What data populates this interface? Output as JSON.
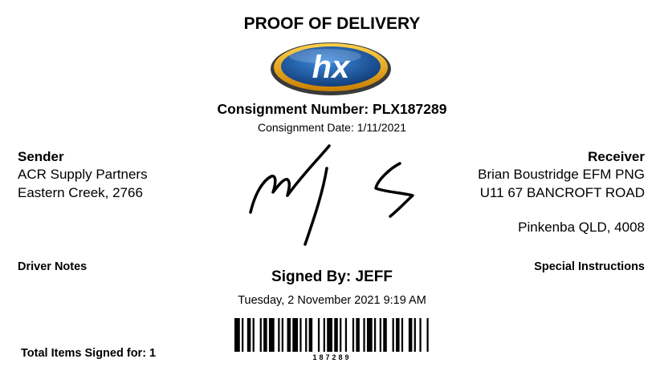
{
  "document": {
    "title": "PROOF OF DELIVERY",
    "logo_text": "hx",
    "consignment_number": "Consignment Number: PLX187289",
    "consignment_date": "Consignment Date: 1/11/2021"
  },
  "sender": {
    "heading": "Sender",
    "lines": [
      "ACR Supply Partners",
      "Eastern Creek, 2766"
    ]
  },
  "receiver": {
    "heading": "Receiver",
    "lines": [
      "Brian Boustridge EFM PNG",
      "U11 67 BANCROFT ROAD",
      "",
      "Pinkenba QLD, 4008"
    ]
  },
  "notes": {
    "driver_notes": "Driver Notes",
    "special_instructions": "Special Instructions"
  },
  "signature": {
    "signed_by": "Signed By: JEFF",
    "signed_date": "Tuesday, 2 November 2021 9:19 AM"
  },
  "totals": {
    "items_signed": "Total Items Signed for: 1"
  },
  "barcode": {
    "value": "187289"
  },
  "colors": {
    "logo_blue": "#1f5fa8",
    "logo_gold": "#e8a317",
    "logo_dark": "#2b2b2b"
  }
}
